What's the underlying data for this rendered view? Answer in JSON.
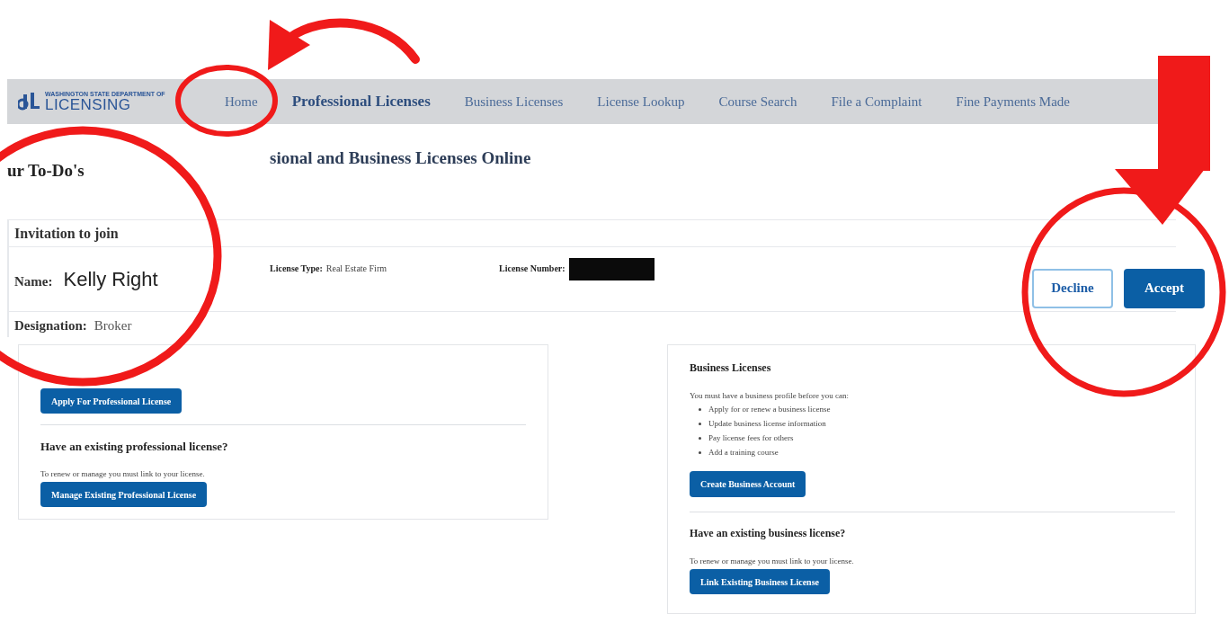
{
  "logo": {
    "top_line": "WASHINGTON STATE DEPARTMENT OF",
    "name": "LICENSING"
  },
  "nav": [
    {
      "label": "Home",
      "selected": false
    },
    {
      "label": "Professional Licenses",
      "selected": true
    },
    {
      "label": "Business Licenses",
      "selected": false
    },
    {
      "label": "License Lookup",
      "selected": false
    },
    {
      "label": "Course Search",
      "selected": false
    },
    {
      "label": "File a Complaint",
      "selected": false
    },
    {
      "label": "Fine Payments Made",
      "selected": false
    }
  ],
  "page_title": "sional and Business Licenses Online",
  "todo": {
    "title": "ur To-Do's",
    "heading": "Invitation to join",
    "name_label": "Name:",
    "name_value": "Kelly Right",
    "designation_label": "Designation:",
    "designation_value": "Broker",
    "license_type_label": "License Type:",
    "license_type_value": "Real Estate Firm",
    "license_number_label": "License Number:",
    "buttons": [
      {
        "label": "Decline",
        "kind": "outline"
      },
      {
        "label": "Accept",
        "kind": "primary"
      }
    ]
  },
  "professional": {
    "apply_button": "Apply For Professional License",
    "existing_heading": "Have an existing professional license?",
    "existing_text": "To renew or manage you must link to your license.",
    "manage_button": "Manage Existing Professional License"
  },
  "business": {
    "heading": "Business Licenses",
    "intro": "You must have a business profile before you can:",
    "items": [
      "Apply for or renew a business license",
      "Update business license information",
      "Pay license fees for others",
      "Add a training course"
    ],
    "create_button": "Create Business Account",
    "existing_heading": "Have an existing business license?",
    "existing_text": "To renew or manage you must link to your license.",
    "link_button": "Link Existing Business License"
  }
}
